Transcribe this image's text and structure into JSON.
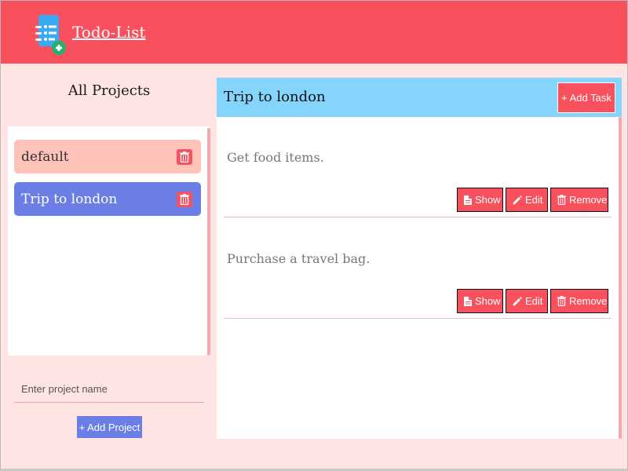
{
  "header": {
    "app_title": "Todo-List",
    "logo_icon": "todo-list-add-icon",
    "background_color": "#f9505e"
  },
  "sidebar": {
    "title": "All Projects",
    "projects": [
      {
        "label": "default",
        "selected": false,
        "color": "#fec2b8"
      },
      {
        "label": "Trip to london",
        "selected": true,
        "color": "#6a7ee6"
      }
    ],
    "delete_icon": "trash-icon",
    "new_project": {
      "placeholder": "Enter project name",
      "value": ""
    },
    "add_project_label": "+ Add Project"
  },
  "main": {
    "project_title": "Trip to london",
    "add_task_label": "+ Add Task",
    "tasks": [
      {
        "text": "Get food items."
      },
      {
        "text": "Purchase a travel bag."
      }
    ],
    "task_actions": {
      "show_label": "Show",
      "edit_label": "Edit",
      "remove_label": "Remove",
      "show_icon": "document-icon",
      "edit_icon": "pencil-icon",
      "remove_icon": "trash-icon"
    },
    "header_color": "#84d4fc"
  }
}
